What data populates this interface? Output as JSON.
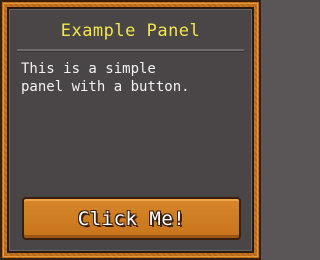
{
  "panel": {
    "title": "Example Panel",
    "body_text": "This is a simple\npanel with a button.",
    "button_label": "Click Me!"
  },
  "colors": {
    "frame": "#c9741f",
    "panel_bg": "#4a4648",
    "title": "#f3e64a",
    "button": "#d7862a"
  }
}
